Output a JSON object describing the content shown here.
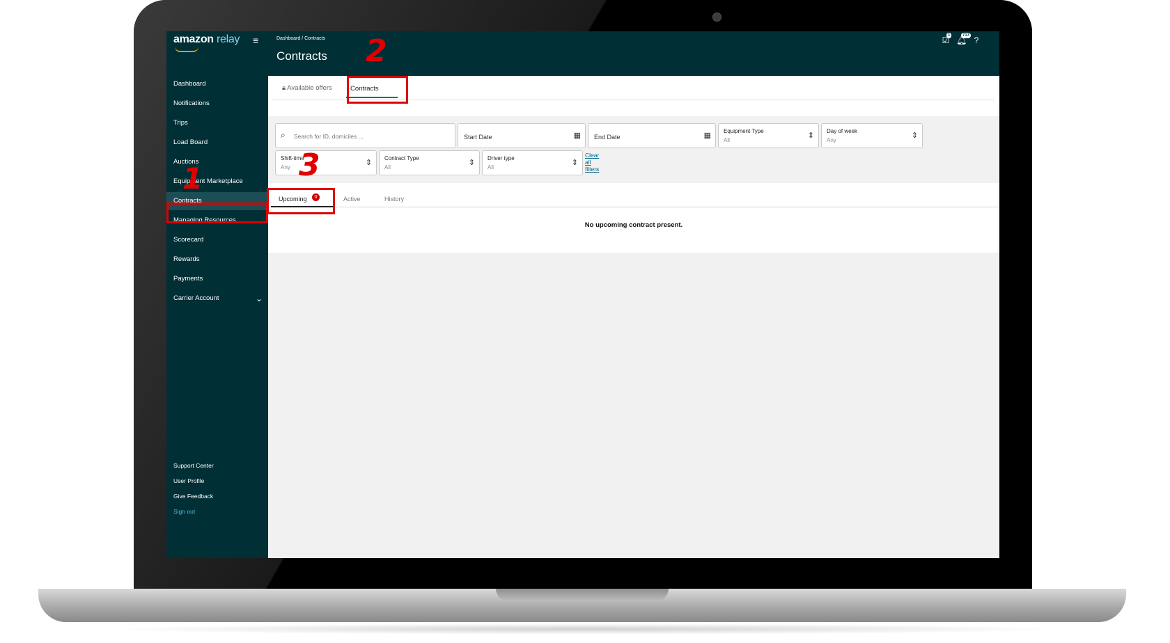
{
  "app": {
    "logo_primary": "amazon",
    "logo_secondary": "relay",
    "accent_color": "#002f36",
    "link_color": "#00688b"
  },
  "header": {
    "breadcrumb": "Dashboard  /  Contracts",
    "title": "Contracts",
    "icons": [
      "task-icon",
      "bell-icon",
      "help-icon"
    ],
    "task_badge": "1",
    "bell_badge": "717"
  },
  "sidebar": {
    "items": [
      {
        "label": "Dashboard"
      },
      {
        "label": "Notifications"
      },
      {
        "label": "Trips"
      },
      {
        "label": "Load Board"
      },
      {
        "label": "Auctions"
      },
      {
        "label": "Equipment Marketplace"
      },
      {
        "label": "Contracts"
      },
      {
        "label": "Managing Resources"
      },
      {
        "label": "Scorecard"
      },
      {
        "label": "Rewards"
      },
      {
        "label": "Payments"
      },
      {
        "label": "Carrier Account"
      }
    ],
    "footer": [
      {
        "label": "Support Center"
      },
      {
        "label": "User Profile"
      },
      {
        "label": "Give Feedback"
      },
      {
        "label": "Sign out"
      }
    ]
  },
  "main": {
    "tabs": [
      {
        "label": "Available offers"
      },
      {
        "label": "Contracts"
      }
    ],
    "filters": {
      "search_placeholder": "Search for ID, domiciles ...",
      "start_date": "Start Date",
      "end_date": "End Date",
      "equipment_type": {
        "label": "Equipment Type",
        "value": "All"
      },
      "day_of_week": {
        "label": "Day of week",
        "value": "Any"
      },
      "shift_time": {
        "label": "Shift-time",
        "value": "Any"
      },
      "contract_type": {
        "label": "Contract Type",
        "value": "All"
      },
      "driver_type": {
        "label": "Driver type",
        "value": "All"
      },
      "clear_all": "Clear all filters"
    },
    "subtabs": [
      {
        "label": "Upcoming",
        "count": "0"
      },
      {
        "label": "Active"
      },
      {
        "label": "History"
      }
    ],
    "empty_message": "No upcoming contract present."
  },
  "annotations": {
    "step1": "1",
    "step2": "2",
    "step3": "3",
    "color": "#e00000"
  }
}
